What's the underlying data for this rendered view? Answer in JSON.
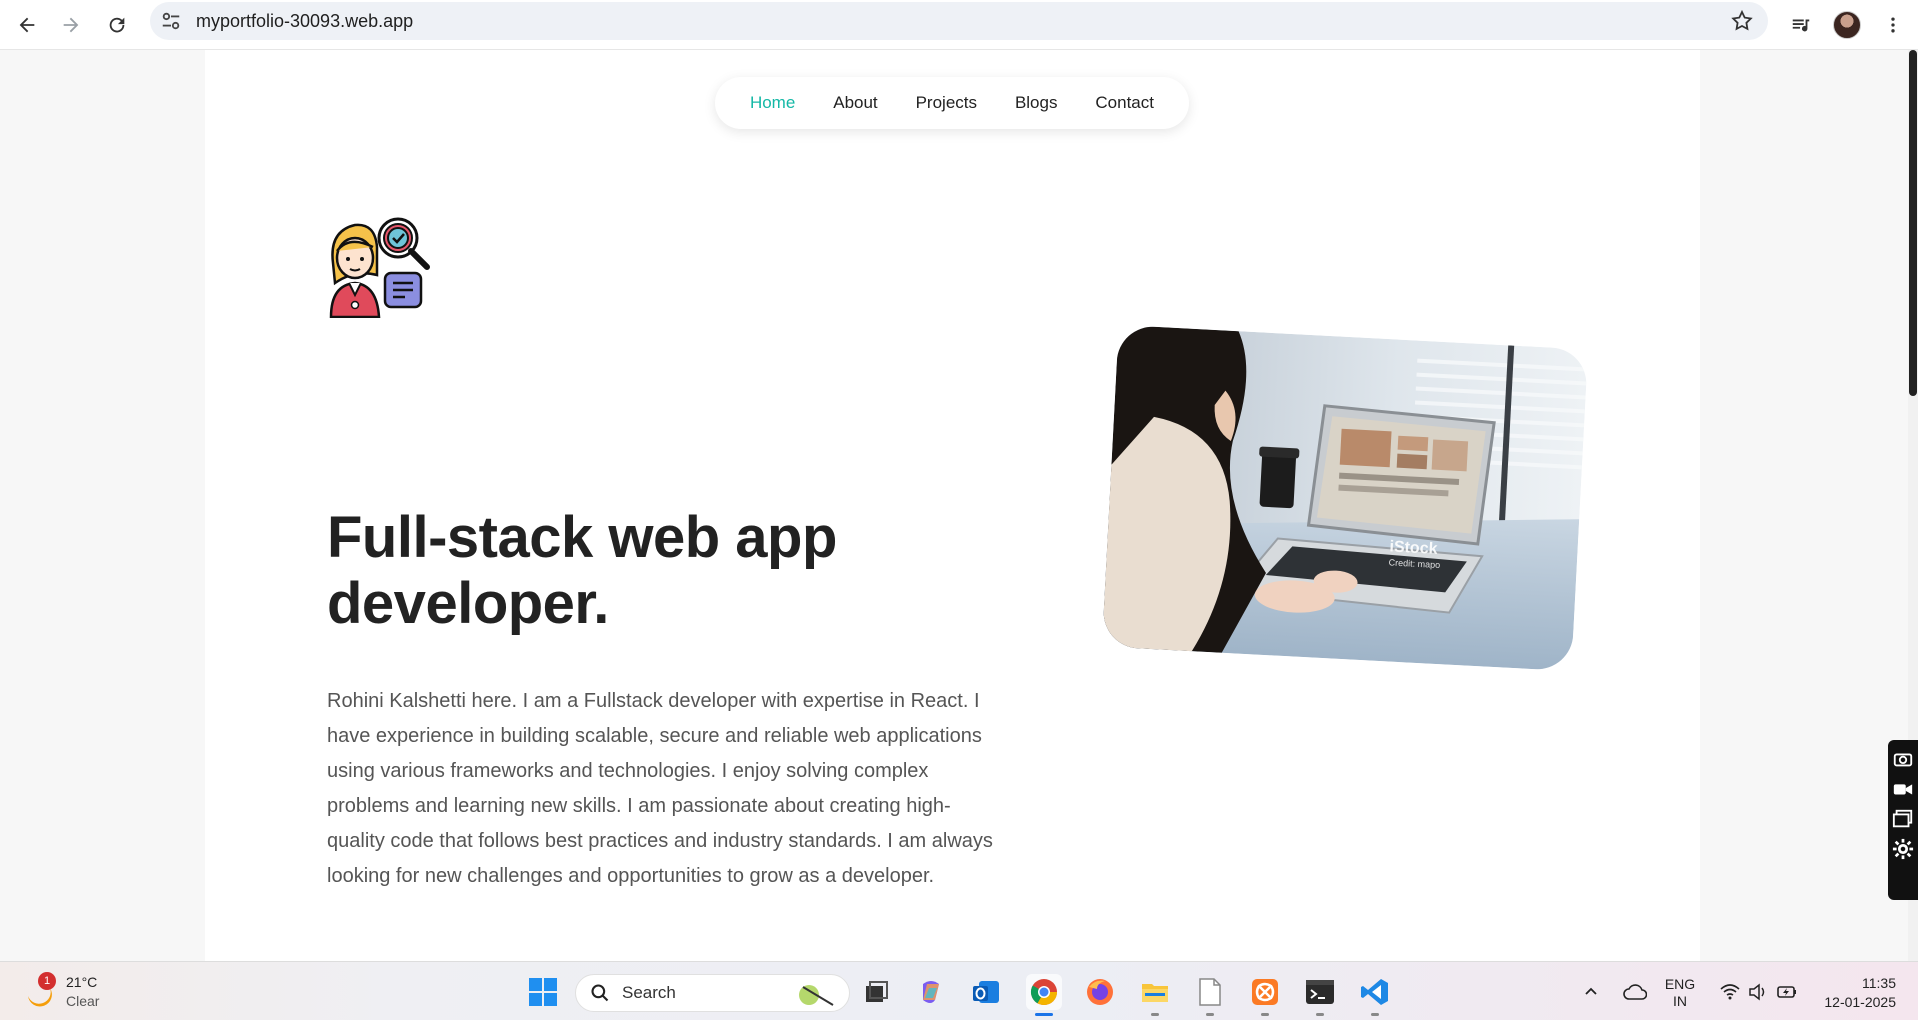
{
  "browser": {
    "url": "myportfolio-30093.web.app"
  },
  "nav": {
    "items": [
      "Home",
      "About",
      "Projects",
      "Blogs",
      "Contact"
    ],
    "active": "Home",
    "accent_color": "#14b8a6"
  },
  "hero": {
    "title": "Full-stack web app developer.",
    "description": "Rohini Kalshetti here. I am a Fullstack developer with expertise in React. I have experience in building scalable, secure and reliable web applications using various frameworks and technologies. I enjoy solving complex problems and learning new skills. I am passionate about creating high-quality code that follows best practices and industry standards. I am always looking for new challenges and opportunities to grow as a developer.",
    "photo": {
      "watermark": "iStock",
      "credit": "Credit: mapo"
    }
  },
  "taskbar": {
    "weather": {
      "temp": "21°C",
      "condition": "Clear",
      "badge": "1"
    },
    "search_placeholder": "Search",
    "language": {
      "line1": "ENG",
      "line2": "IN"
    },
    "time": "11:35",
    "date": "12-01-2025"
  }
}
